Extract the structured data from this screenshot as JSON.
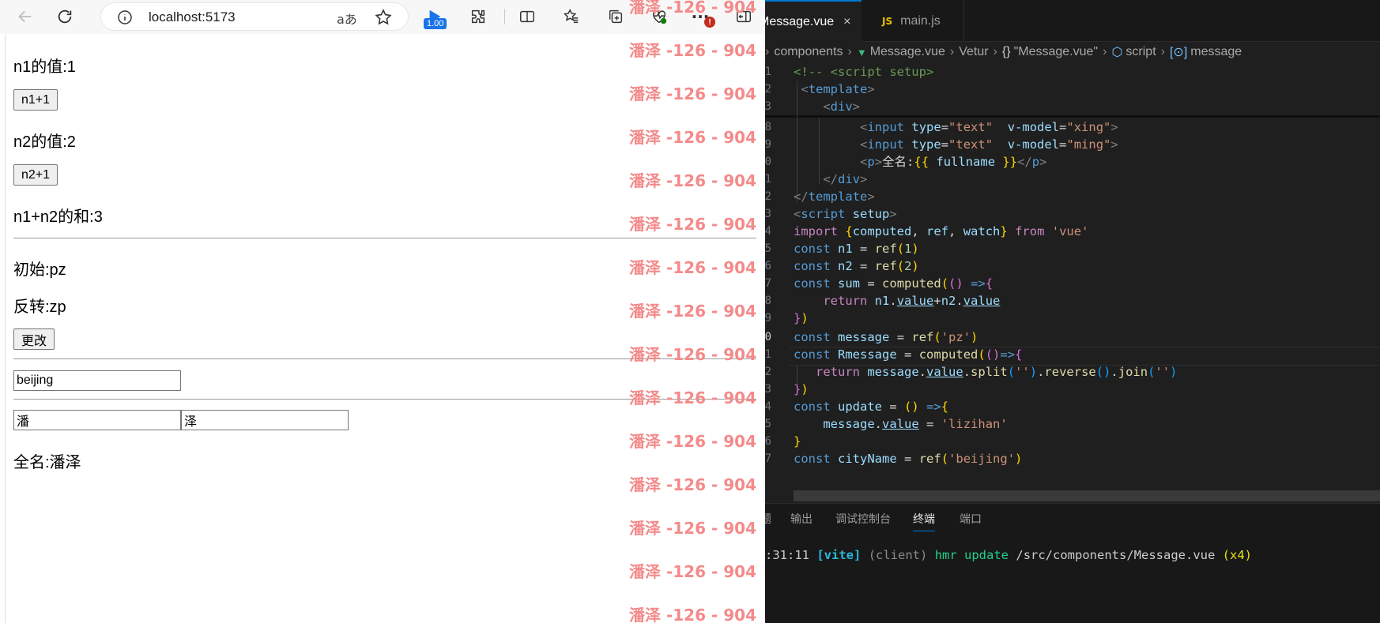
{
  "browser": {
    "url": "localhost:5173",
    "read_aloud": "aあ",
    "speed_badge": "1.00",
    "alert_badge": "!"
  },
  "page": {
    "n1_text": "n1的值:1",
    "n1_button": "n1+1",
    "n2_text": "n2的值:2",
    "n2_button": "n2+1",
    "sum_text": "n1+n2的和:3",
    "original_text": "初始:pz",
    "reversed_text": "反转:zp",
    "change_button": "更改",
    "city_value": "beijing",
    "xing_value": "潘",
    "ming_value": "泽",
    "fullname_text": "全名:潘泽"
  },
  "watermark": {
    "text": "潘泽 -126 - 904",
    "count": 15
  },
  "editor": {
    "tabs": [
      {
        "label": "Message.vue",
        "close": "×"
      },
      {
        "label": "main.js",
        "badge": "JS"
      }
    ],
    "breadcrumb": {
      "folder": "components",
      "file": "Message.vue",
      "extension": "Vetur",
      "component": "\"Message.vue\"",
      "section": "script",
      "symbol": "message"
    },
    "line_numbers": [
      "1",
      "2",
      "3",
      "8",
      "9",
      "0",
      "1",
      "2",
      "3",
      "4",
      "5",
      "6",
      "7",
      "8",
      "9",
      "0",
      "1",
      "2",
      "3",
      "4",
      "5",
      "6",
      "7"
    ],
    "active_line_index": 15
  },
  "panel": {
    "tabs": [
      "题",
      "输出",
      "调试控制台",
      "终端",
      "端口"
    ],
    "active_tab": "终端",
    "terminal": {
      "time": ":31:11",
      "tag": "[vite]",
      "client": "(client)",
      "action": "hmr update",
      "path": "/src/components/Message.vue",
      "count": "(x4)"
    }
  }
}
